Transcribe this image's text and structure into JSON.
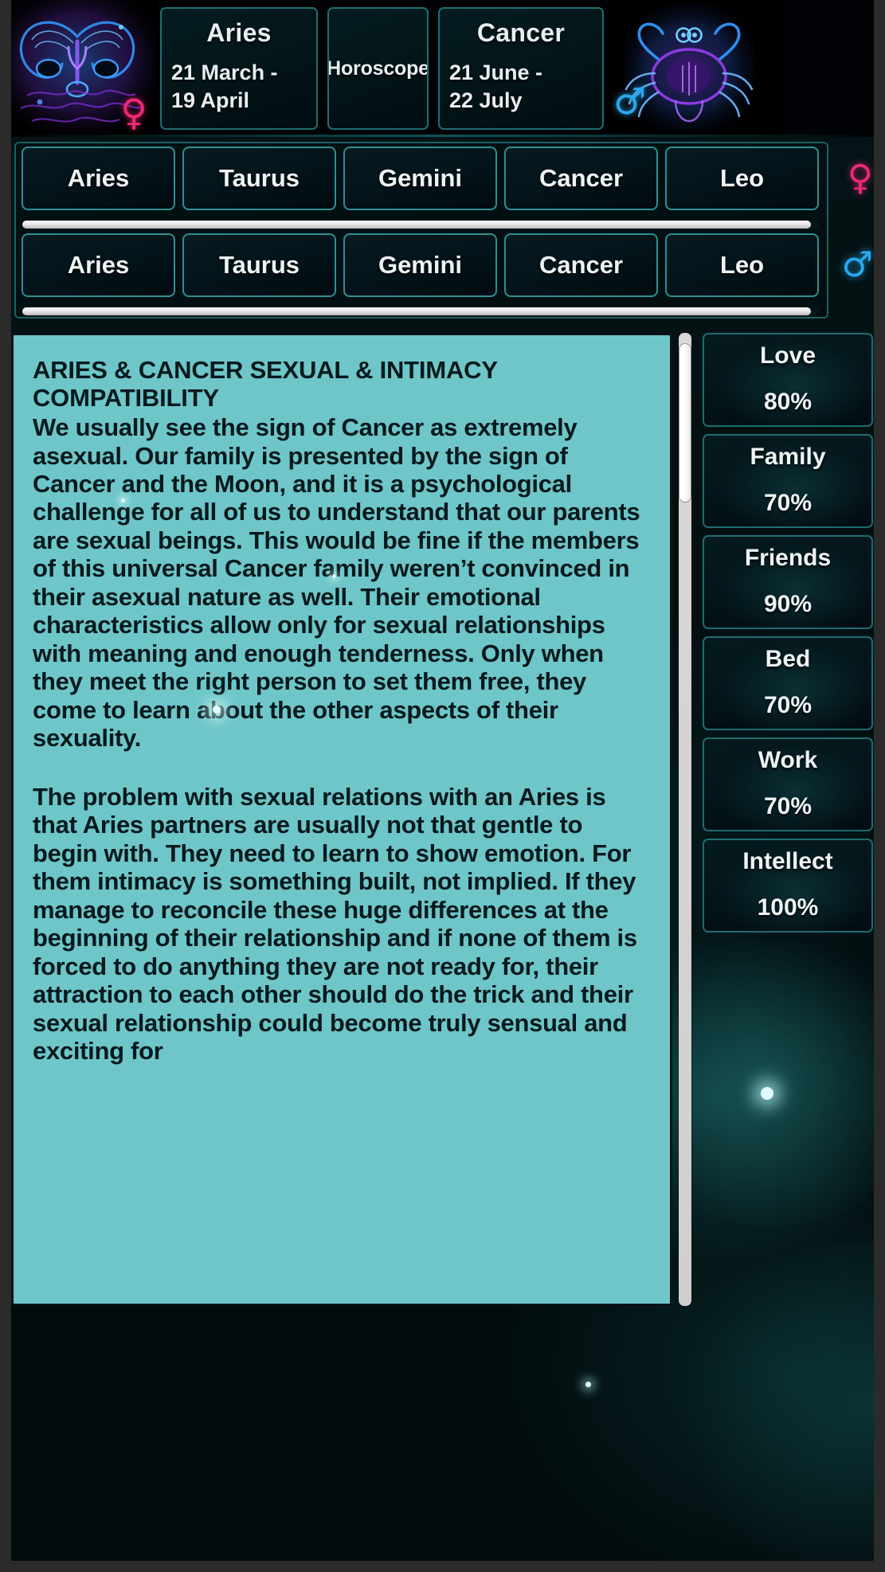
{
  "header": {
    "left_sign": {
      "art_icon": "aries-ram-illustration",
      "gender_icon": "venus-symbol",
      "gender_glyph": "♀",
      "name": "Aries",
      "dates": "21 March  -\n19 April"
    },
    "middle": {
      "label": "Horoscope"
    },
    "right_sign": {
      "art_icon": "cancer-crab-illustration",
      "gender_icon": "mars-symbol",
      "gender_glyph": "♂",
      "name": "Cancer",
      "dates": "21 June -\n22 July"
    }
  },
  "selectors": {
    "row1": {
      "gender_icon": "venus-symbol",
      "gender_glyph": "♀",
      "signs": [
        "Aries",
        "Taurus",
        "Gemini",
        "Cancer",
        "Leo"
      ],
      "selected": "Aries"
    },
    "row2": {
      "gender_icon": "mars-symbol",
      "gender_glyph": "♂",
      "signs": [
        "Aries",
        "Taurus",
        "Gemini",
        "Cancer",
        "Leo"
      ],
      "selected": "Cancer"
    }
  },
  "reading": {
    "heading": "ARIES & CANCER SEXUAL & INTIMACY COMPATIBILITY",
    "paragraph1": "We usually see the sign of Cancer as extremely asexual. Our family is presented by the sign of Cancer and the Moon, and it is a psychological challenge for all of us to understand that our parents are sexual beings. This would be fine if the members of this universal Cancer family weren’t convinced in their asexual nature as well. Their emotional characteristics allow only for sexual relationships with meaning and enough tenderness. Only when they meet the right person to set them free, they come to learn about the other aspects of their sexuality.",
    "paragraph2": "The problem with sexual relations with an Aries is that Aries partners are usually not that gentle to begin with. They need to learn to show emotion. For them intimacy is something built, not implied. If they manage to reconcile these huge differences at the beginning of their relationship and if none of them is forced to do anything they are not ready for, their attraction to each other should do the trick and their sexual relationship could become truly sensual and exciting for"
  },
  "stats": [
    {
      "label": "Love",
      "value": "80%"
    },
    {
      "label": "Family",
      "value": "70%"
    },
    {
      "label": "Friends",
      "value": "90%"
    },
    {
      "label": "Bed",
      "value": "70%"
    },
    {
      "label": "Work",
      "value": "70%"
    },
    {
      "label": "Intellect",
      "value": "100%"
    }
  ],
  "colors": {
    "panel_teal": "#6ec6c9",
    "accent_border": "#2c8f93",
    "venus_pink": "#ec2a74",
    "mars_blue": "#29a8ee",
    "background_dark": "#031012"
  }
}
